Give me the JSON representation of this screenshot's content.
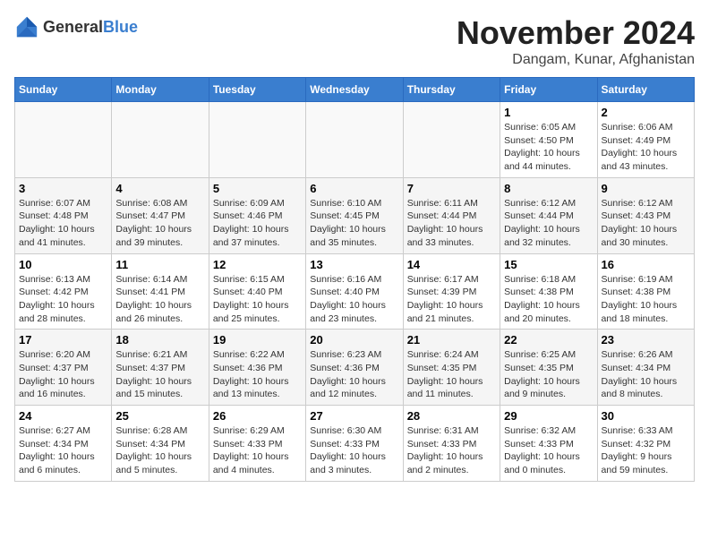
{
  "header": {
    "logo_general": "General",
    "logo_blue": "Blue",
    "month": "November 2024",
    "location": "Dangam, Kunar, Afghanistan"
  },
  "weekdays": [
    "Sunday",
    "Monday",
    "Tuesday",
    "Wednesday",
    "Thursday",
    "Friday",
    "Saturday"
  ],
  "weeks": [
    [
      {
        "day": "",
        "info": ""
      },
      {
        "day": "",
        "info": ""
      },
      {
        "day": "",
        "info": ""
      },
      {
        "day": "",
        "info": ""
      },
      {
        "day": "",
        "info": ""
      },
      {
        "day": "1",
        "info": "Sunrise: 6:05 AM\nSunset: 4:50 PM\nDaylight: 10 hours\nand 44 minutes."
      },
      {
        "day": "2",
        "info": "Sunrise: 6:06 AM\nSunset: 4:49 PM\nDaylight: 10 hours\nand 43 minutes."
      }
    ],
    [
      {
        "day": "3",
        "info": "Sunrise: 6:07 AM\nSunset: 4:48 PM\nDaylight: 10 hours\nand 41 minutes."
      },
      {
        "day": "4",
        "info": "Sunrise: 6:08 AM\nSunset: 4:47 PM\nDaylight: 10 hours\nand 39 minutes."
      },
      {
        "day": "5",
        "info": "Sunrise: 6:09 AM\nSunset: 4:46 PM\nDaylight: 10 hours\nand 37 minutes."
      },
      {
        "day": "6",
        "info": "Sunrise: 6:10 AM\nSunset: 4:45 PM\nDaylight: 10 hours\nand 35 minutes."
      },
      {
        "day": "7",
        "info": "Sunrise: 6:11 AM\nSunset: 4:44 PM\nDaylight: 10 hours\nand 33 minutes."
      },
      {
        "day": "8",
        "info": "Sunrise: 6:12 AM\nSunset: 4:44 PM\nDaylight: 10 hours\nand 32 minutes."
      },
      {
        "day": "9",
        "info": "Sunrise: 6:12 AM\nSunset: 4:43 PM\nDaylight: 10 hours\nand 30 minutes."
      }
    ],
    [
      {
        "day": "10",
        "info": "Sunrise: 6:13 AM\nSunset: 4:42 PM\nDaylight: 10 hours\nand 28 minutes."
      },
      {
        "day": "11",
        "info": "Sunrise: 6:14 AM\nSunset: 4:41 PM\nDaylight: 10 hours\nand 26 minutes."
      },
      {
        "day": "12",
        "info": "Sunrise: 6:15 AM\nSunset: 4:40 PM\nDaylight: 10 hours\nand 25 minutes."
      },
      {
        "day": "13",
        "info": "Sunrise: 6:16 AM\nSunset: 4:40 PM\nDaylight: 10 hours\nand 23 minutes."
      },
      {
        "day": "14",
        "info": "Sunrise: 6:17 AM\nSunset: 4:39 PM\nDaylight: 10 hours\nand 21 minutes."
      },
      {
        "day": "15",
        "info": "Sunrise: 6:18 AM\nSunset: 4:38 PM\nDaylight: 10 hours\nand 20 minutes."
      },
      {
        "day": "16",
        "info": "Sunrise: 6:19 AM\nSunset: 4:38 PM\nDaylight: 10 hours\nand 18 minutes."
      }
    ],
    [
      {
        "day": "17",
        "info": "Sunrise: 6:20 AM\nSunset: 4:37 PM\nDaylight: 10 hours\nand 16 minutes."
      },
      {
        "day": "18",
        "info": "Sunrise: 6:21 AM\nSunset: 4:37 PM\nDaylight: 10 hours\nand 15 minutes."
      },
      {
        "day": "19",
        "info": "Sunrise: 6:22 AM\nSunset: 4:36 PM\nDaylight: 10 hours\nand 13 minutes."
      },
      {
        "day": "20",
        "info": "Sunrise: 6:23 AM\nSunset: 4:36 PM\nDaylight: 10 hours\nand 12 minutes."
      },
      {
        "day": "21",
        "info": "Sunrise: 6:24 AM\nSunset: 4:35 PM\nDaylight: 10 hours\nand 11 minutes."
      },
      {
        "day": "22",
        "info": "Sunrise: 6:25 AM\nSunset: 4:35 PM\nDaylight: 10 hours\nand 9 minutes."
      },
      {
        "day": "23",
        "info": "Sunrise: 6:26 AM\nSunset: 4:34 PM\nDaylight: 10 hours\nand 8 minutes."
      }
    ],
    [
      {
        "day": "24",
        "info": "Sunrise: 6:27 AM\nSunset: 4:34 PM\nDaylight: 10 hours\nand 6 minutes."
      },
      {
        "day": "25",
        "info": "Sunrise: 6:28 AM\nSunset: 4:34 PM\nDaylight: 10 hours\nand 5 minutes."
      },
      {
        "day": "26",
        "info": "Sunrise: 6:29 AM\nSunset: 4:33 PM\nDaylight: 10 hours\nand 4 minutes."
      },
      {
        "day": "27",
        "info": "Sunrise: 6:30 AM\nSunset: 4:33 PM\nDaylight: 10 hours\nand 3 minutes."
      },
      {
        "day": "28",
        "info": "Sunrise: 6:31 AM\nSunset: 4:33 PM\nDaylight: 10 hours\nand 2 minutes."
      },
      {
        "day": "29",
        "info": "Sunrise: 6:32 AM\nSunset: 4:33 PM\nDaylight: 10 hours\nand 0 minutes."
      },
      {
        "day": "30",
        "info": "Sunrise: 6:33 AM\nSunset: 4:32 PM\nDaylight: 9 hours\nand 59 minutes."
      }
    ]
  ]
}
